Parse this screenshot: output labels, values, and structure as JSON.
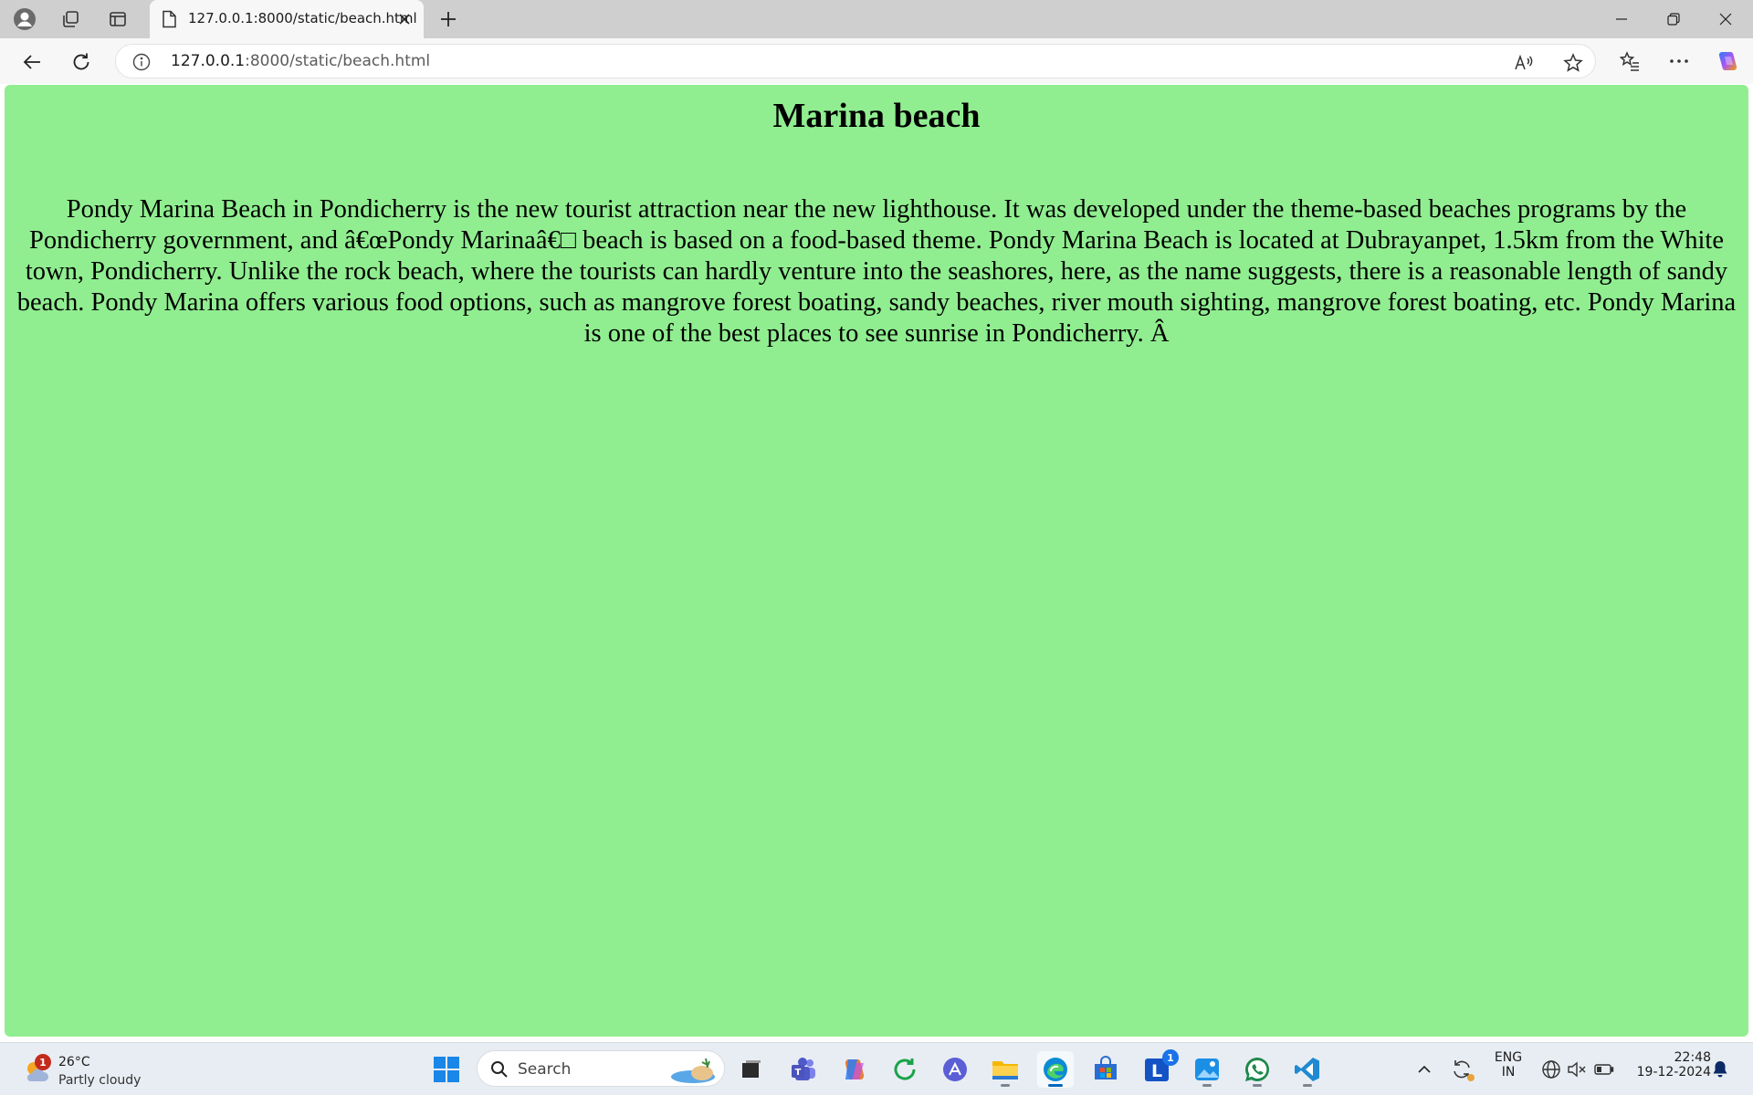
{
  "browser": {
    "tab_title": "127.0.0.1:8000/static/beach.html",
    "url_host": "127.0.0.1",
    "url_rest": ":8000/static/beach.html"
  },
  "page": {
    "heading": "Marina beach",
    "paragraph": "Pondy Marina Beach in Pondicherry is the new tourist attraction near the new lighthouse. It was developed under the theme-based beaches programs by the Pondicherry government, and â€œPondy Marinaâ€□ beach is based on a food-based theme. Pondy Marina Beach is located at Dubrayanpet, 1.5km from the White town, Pondicherry. Unlike the rock beach, where the tourists can hardly venture into the seashores, here, as the name suggests, there is a reasonable length of sandy beach. Pondy Marina offers various food options, such as mangrove forest boating, sandy beaches, river mouth sighting, mangrove forest boating, etc. Pondy Marina is one of the best places to see sunrise in Pondicherry. Â",
    "background_color": "#90ee90"
  },
  "taskbar": {
    "weather_temp": "26°C",
    "weather_desc": "Partly cloudy",
    "weather_badge": "1",
    "search_label": "Search",
    "linkedin_badge": "1",
    "language_top": "ENG",
    "language_bottom": "IN",
    "time": "22:48",
    "date": "19-12-2024"
  }
}
